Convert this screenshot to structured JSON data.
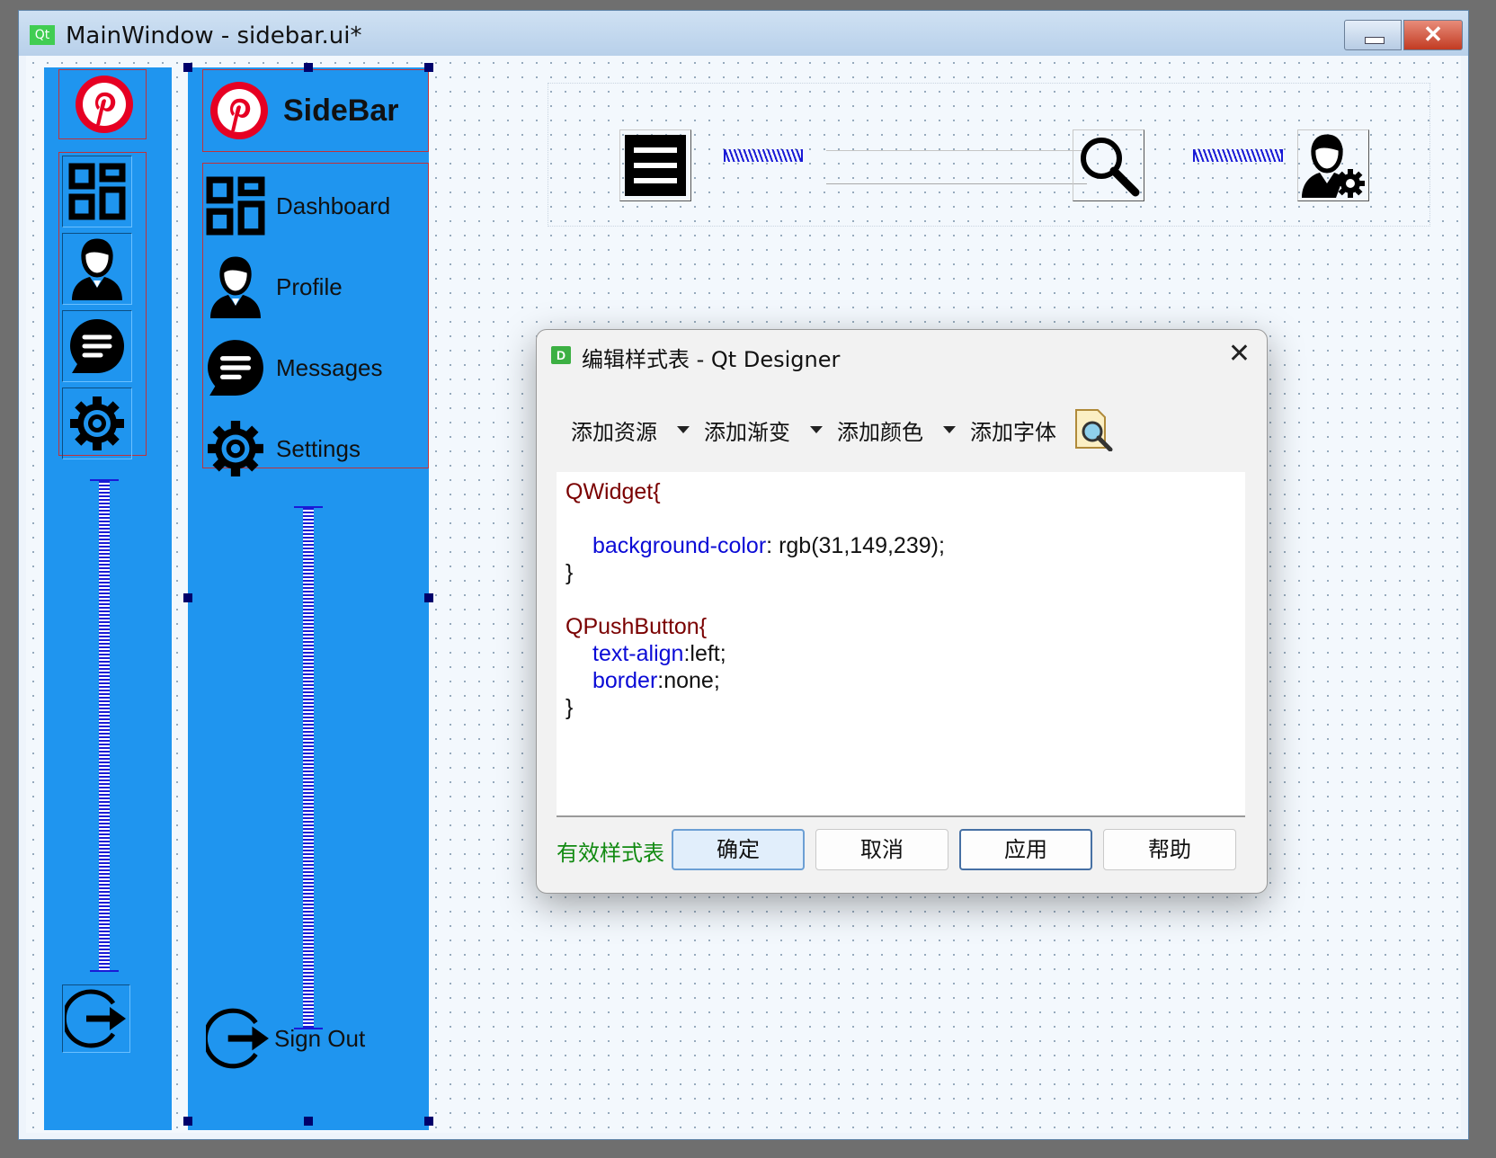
{
  "window": {
    "app_logo": "Qt",
    "title": "MainWindow - sidebar.ui*",
    "close_glyph": "✕"
  },
  "sidebar_narrow": {
    "items": [
      "pinterest-logo",
      "dashboard-icon",
      "profile-icon",
      "messages-icon",
      "settings-icon"
    ],
    "signout_icon": "signout-icon"
  },
  "sidebar_wide": {
    "brand": "SideBar",
    "items": [
      {
        "label": "Dashboard",
        "icon": "dashboard-icon"
      },
      {
        "label": "Profile",
        "icon": "profile-icon"
      },
      {
        "label": "Messages",
        "icon": "messages-icon"
      },
      {
        "label": "Settings",
        "icon": "settings-icon"
      }
    ],
    "signout": "Sign Out"
  },
  "topbar": {
    "menu_icon": "hamburger-icon",
    "search_icon": "search-icon",
    "user_icon": "user-settings-icon",
    "search_value": ""
  },
  "dialog": {
    "logo": "D",
    "title": "编辑样式表 - Qt Designer",
    "close_glyph": "✕",
    "toolbar": [
      "添加资源",
      "添加渐变",
      "添加颜色",
      "添加字体"
    ],
    "stylesheet": {
      "l1": "QWidget{",
      "l2_prop": "background-color",
      "l2_val": ": rgb(31,149,239);",
      "l3": "}",
      "l4": "QPushButton{",
      "l5_prop": "text-align",
      "l5_val": ":left;",
      "l6_prop": "border",
      "l6_val": ":none;",
      "l7": "}"
    },
    "status": "有效样式表",
    "buttons": {
      "ok": "确定",
      "cancel": "取消",
      "apply": "应用",
      "help": "帮助"
    }
  },
  "colors": {
    "sidebar_bg": "#1f95ef",
    "pinterest": "#e60023",
    "valid_green": "#118a11"
  }
}
